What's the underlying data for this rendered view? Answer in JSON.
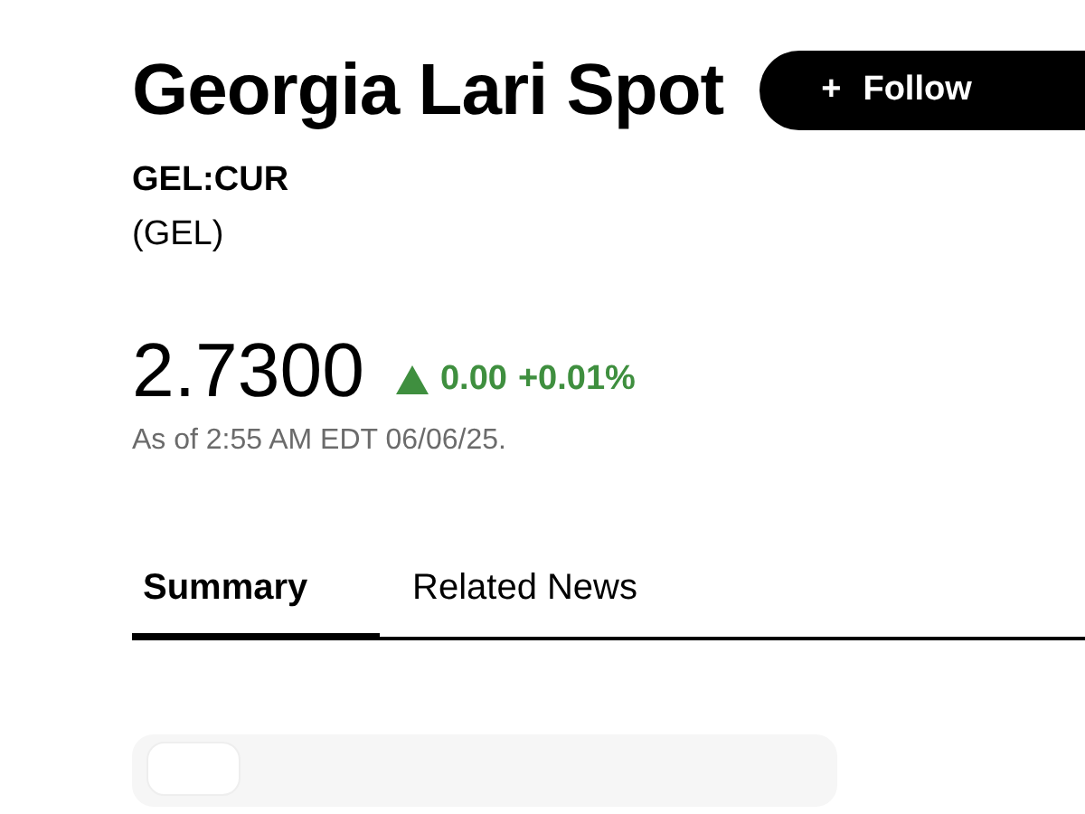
{
  "header": {
    "title": "Georgia Lari Spot",
    "follow_button": {
      "icon": "+",
      "label": "Follow"
    },
    "ticker": "GEL:CUR",
    "currency": "(GEL)"
  },
  "quote": {
    "price": "2.7300",
    "up": true,
    "change": "0.00",
    "change_percent": "+0.01%",
    "as_of": "As of 2:55 AM EDT 06/06/25."
  },
  "tabs": [
    {
      "label": "Summary",
      "selected": true
    },
    {
      "label": "Related News",
      "selected": false
    }
  ]
}
